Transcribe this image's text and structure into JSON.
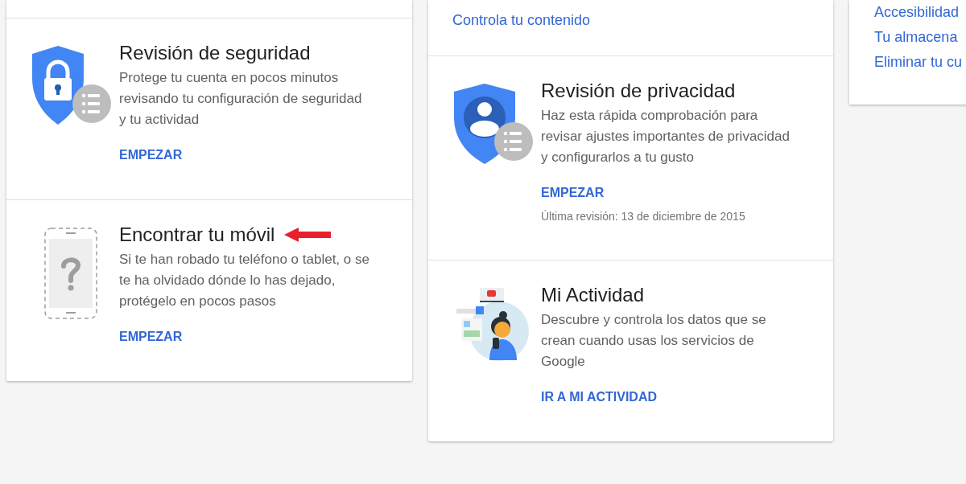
{
  "left_column": {
    "sections": [
      {
        "kind": "security",
        "title": "Revisión de seguridad",
        "description": "Protege tu cuenta en pocos minutos revisando tu configuración de seguridad y tu actividad",
        "action": "EMPEZAR",
        "annotated": false
      },
      {
        "kind": "phone",
        "title": "Encontrar tu móvil",
        "description": "Si te han robado tu teléfono o tablet, o se te ha olvidado dónde lo has dejado, protégelo en pocos pasos",
        "action": "EMPEZAR",
        "annotated": true
      }
    ]
  },
  "middle_column": {
    "top_link": "Controla tu contenido",
    "sections": [
      {
        "kind": "privacy",
        "title": "Revisión de privacidad",
        "description": "Haz esta rápida comprobación para revisar ajustes importantes de privacidad y configurarlos a tu gusto",
        "action": "EMPEZAR",
        "note": "Última revisión: 13 de diciembre de 2015"
      },
      {
        "kind": "activity",
        "title": "Mi Actividad",
        "description": "Descubre y controla los datos que se crean cuando usas los servicios de Google",
        "action": "IR A MI ACTIVIDAD"
      }
    ]
  },
  "right_column": {
    "links": [
      "Accesibilidad",
      "Tu almacena",
      "Eliminar tu cu"
    ]
  }
}
